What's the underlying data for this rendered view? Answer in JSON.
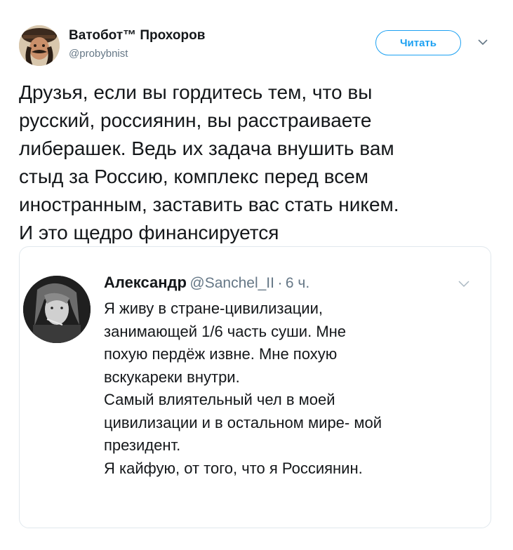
{
  "tweet": {
    "author_name": "Ватобот™ Прохоров",
    "author_handle": "@probybnist",
    "follow_label": "Читать",
    "text": "Друзья, если вы гордитесь тем, что вы\nрусский, россиянин, вы расстраиваете\nлиберашек. Ведь их задача внушить вам\nстыд за Россию, комплекс перед всем\nиностранным, заставить вас стать никем.\nИ это щедро финансируется"
  },
  "quote": {
    "author_name": "Александр",
    "author_handle": "@Sanchel_II",
    "separator": "·",
    "time": "6 ч.",
    "text": "Я живу в стране-цивилизации,\nзанимающей 1/6 часть суши. Мне\nпохую пердёж извне. Мне похую\nвскукареки внутри.\nСамый влиятельный чел в моей\nцивилизации и в остальном мире- мой\nпрезидент.\nЯ кайфую, от того, что я Россиянин."
  },
  "colors": {
    "accent": "#1da1f2",
    "secondary_text": "#657786",
    "border": "#e1e8ed"
  },
  "icons": {
    "tweet_menu": "chevron-down-icon",
    "quote_menu": "chevron-down-icon"
  }
}
